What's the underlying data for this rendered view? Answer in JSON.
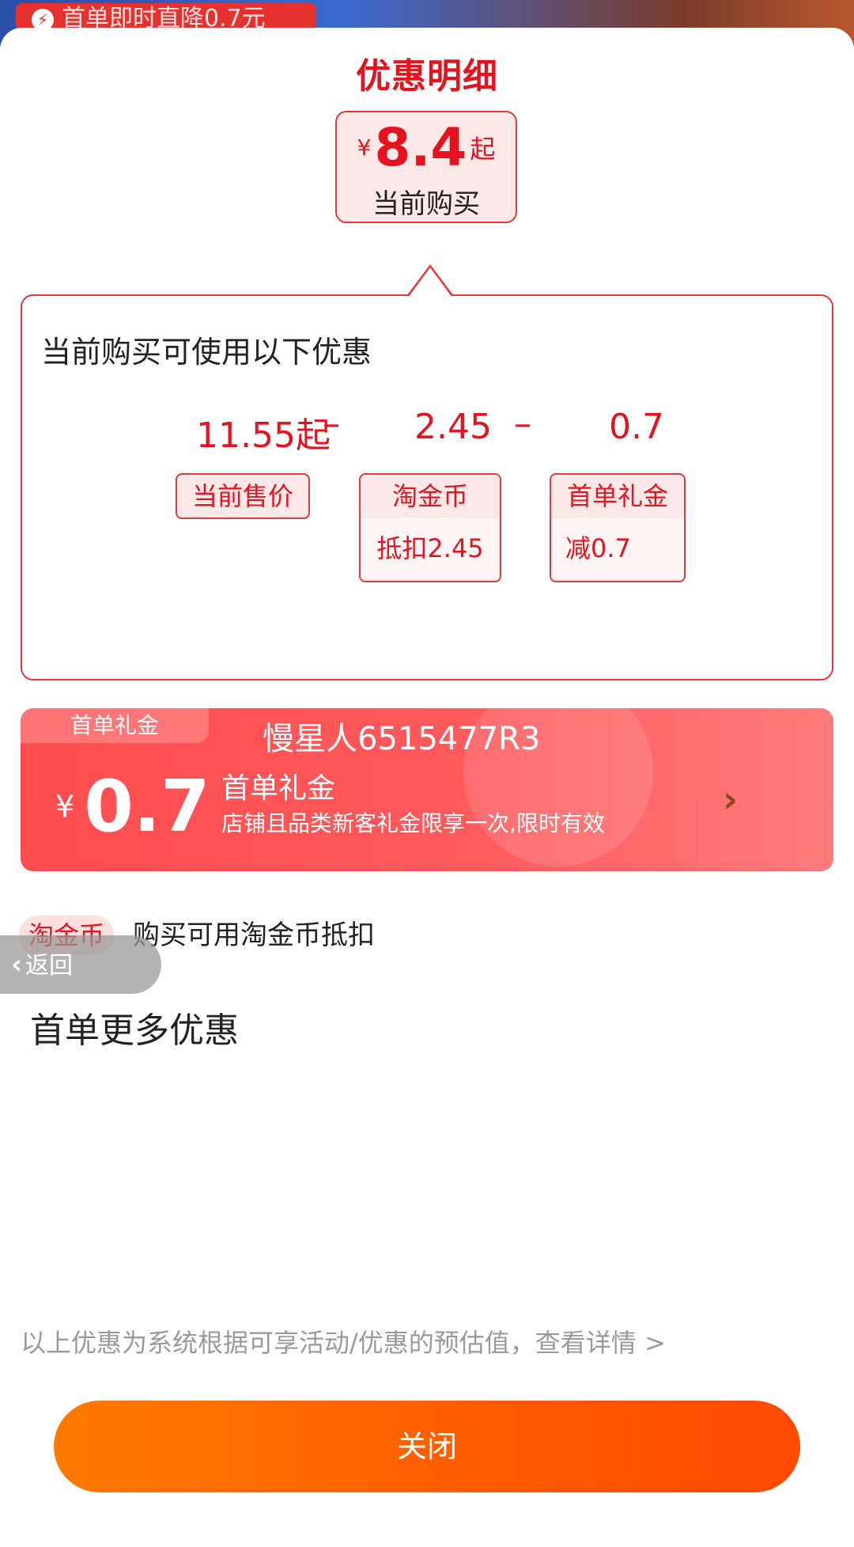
{
  "background": {
    "promo_text": "首单即时直降0.7元"
  },
  "sheet": {
    "title": "优惠明细",
    "price_box": {
      "currency": "¥",
      "amount": "8.4",
      "suffix": "起",
      "label": "当前购买"
    },
    "card": {
      "heading": "当前购买可使用以下优惠",
      "formula": {
        "base": "11.55起",
        "op1": "–",
        "deduct1": "2.45",
        "op2": "–",
        "deduct2": "0.7"
      },
      "tags": [
        {
          "title": "当前售价"
        },
        {
          "title": "淘金币",
          "detail": "抵扣2.45"
        },
        {
          "title": "首单礼金",
          "detail": "减0.7"
        }
      ]
    },
    "coupon": {
      "corner_label": "首单礼金",
      "shop_name": "慢星人6515477R3",
      "currency": "¥",
      "amount": "0.7",
      "name": "首单礼金",
      "description": "店铺且品类新客礼金限享一次,限时有效",
      "chevron_icon": "chevron-right-icon"
    },
    "taojin": {
      "badge": "淘金币",
      "text": "购买可用淘金币抵扣"
    },
    "back_button": {
      "label": "返回",
      "icon": "chevron-left-icon"
    },
    "more_title": "首单更多优惠",
    "footnote": "以上优惠为系统根据可享活动/优惠的预估值，查看详情 >",
    "close_label": "关闭"
  },
  "colors": {
    "accent": "#e4131f",
    "coupon": "#ff4d4f",
    "close_button": "#ff6a00"
  }
}
